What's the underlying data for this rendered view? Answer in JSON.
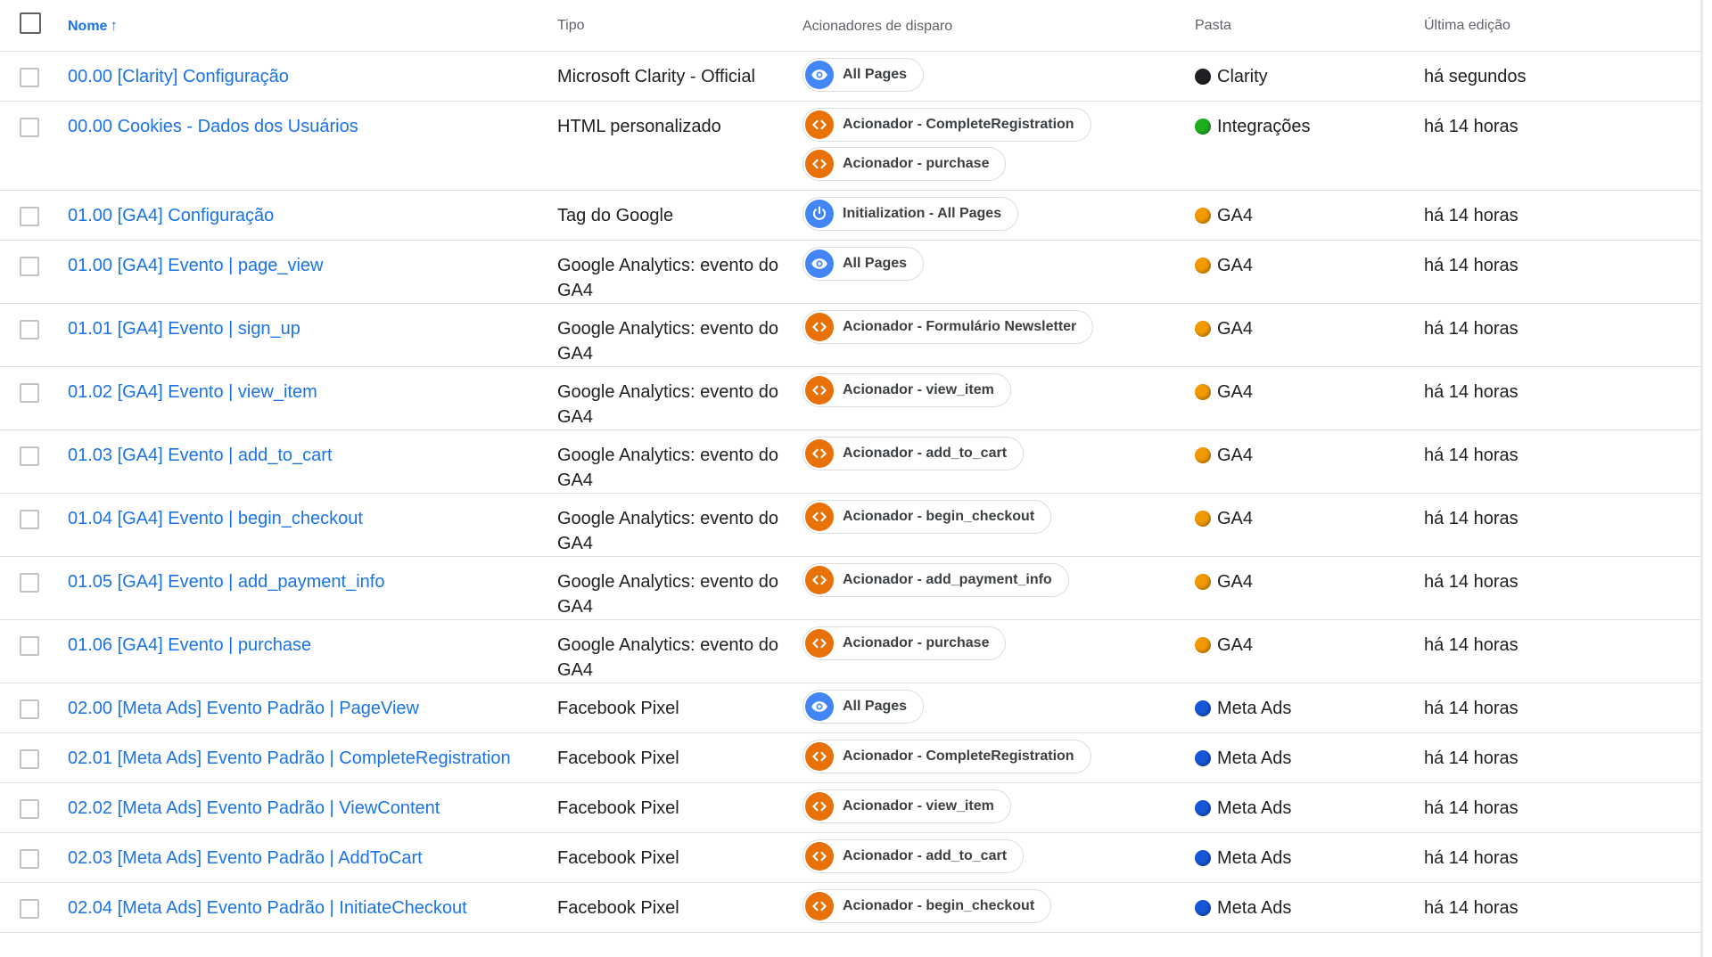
{
  "header": {
    "col_name": "Nome",
    "col_type": "Tipo",
    "col_triggers": "Acionadores de disparo",
    "col_folder": "Pasta",
    "col_edited": "Última edição"
  },
  "folder_colors": {
    "Clarity": "#202124",
    "Integrações": "#1db01d",
    "GA4": "#f29900",
    "Meta Ads": "#1558d6"
  },
  "trigger_colors": {
    "eye": "#4285f4",
    "power": "#4285f4",
    "code": "#e8710a"
  },
  "rows": [
    {
      "name": "00.00 [Clarity] Configuração",
      "type": "Microsoft Clarity - Official",
      "triggers": [
        {
          "label": "All Pages",
          "icon": "eye"
        }
      ],
      "folder": "Clarity",
      "edited": "há segundos"
    },
    {
      "name": "00.00 Cookies - Dados dos Usuários",
      "type": "HTML personalizado",
      "triggers": [
        {
          "label": "Acionador - CompleteRegistration",
          "icon": "code"
        },
        {
          "label": "Acionador - purchase",
          "icon": "code"
        }
      ],
      "folder": "Integrações",
      "edited": "há 14 horas"
    },
    {
      "name": "01.00 [GA4] Configuração",
      "type": "Tag do Google",
      "triggers": [
        {
          "label": "Initialization - All Pages",
          "icon": "power"
        }
      ],
      "folder": "GA4",
      "edited": "há 14 horas"
    },
    {
      "name": "01.00 [GA4] Evento | page_view",
      "type": "Google Analytics: evento do GA4",
      "triggers": [
        {
          "label": "All Pages",
          "icon": "eye"
        }
      ],
      "folder": "GA4",
      "edited": "há 14 horas"
    },
    {
      "name": "01.01 [GA4] Evento | sign_up",
      "type": "Google Analytics: evento do GA4",
      "triggers": [
        {
          "label": "Acionador - Formulário Newsletter",
          "icon": "code"
        }
      ],
      "folder": "GA4",
      "edited": "há 14 horas"
    },
    {
      "name": "01.02 [GA4] Evento | view_item",
      "type": "Google Analytics: evento do GA4",
      "triggers": [
        {
          "label": "Acionador - view_item",
          "icon": "code"
        }
      ],
      "folder": "GA4",
      "edited": "há 14 horas"
    },
    {
      "name": "01.03 [GA4] Evento | add_to_cart",
      "type": "Google Analytics: evento do GA4",
      "triggers": [
        {
          "label": "Acionador - add_to_cart",
          "icon": "code"
        }
      ],
      "folder": "GA4",
      "edited": "há 14 horas"
    },
    {
      "name": "01.04 [GA4] Evento | begin_checkout",
      "type": "Google Analytics: evento do GA4",
      "triggers": [
        {
          "label": "Acionador - begin_checkout",
          "icon": "code"
        }
      ],
      "folder": "GA4",
      "edited": "há 14 horas"
    },
    {
      "name": "01.05 [GA4] Evento | add_payment_info",
      "type": "Google Analytics: evento do GA4",
      "triggers": [
        {
          "label": "Acionador - add_payment_info",
          "icon": "code"
        }
      ],
      "folder": "GA4",
      "edited": "há 14 horas"
    },
    {
      "name": "01.06 [GA4] Evento | purchase",
      "type": "Google Analytics: evento do GA4",
      "triggers": [
        {
          "label": "Acionador - purchase",
          "icon": "code"
        }
      ],
      "folder": "GA4",
      "edited": "há 14 horas"
    },
    {
      "name": "02.00 [Meta Ads] Evento Padrão | PageView",
      "type": "Facebook Pixel",
      "triggers": [
        {
          "label": "All Pages",
          "icon": "eye"
        }
      ],
      "folder": "Meta Ads",
      "edited": "há 14 horas"
    },
    {
      "name": "02.01 [Meta Ads] Evento Padrão | CompleteRegistration",
      "type": "Facebook Pixel",
      "triggers": [
        {
          "label": "Acionador - CompleteRegistration",
          "icon": "code"
        }
      ],
      "folder": "Meta Ads",
      "edited": "há 14 horas"
    },
    {
      "name": "02.02 [Meta Ads] Evento Padrão | ViewContent",
      "type": "Facebook Pixel",
      "triggers": [
        {
          "label": "Acionador - view_item",
          "icon": "code"
        }
      ],
      "folder": "Meta Ads",
      "edited": "há 14 horas"
    },
    {
      "name": "02.03 [Meta Ads] Evento Padrão | AddToCart",
      "type": "Facebook Pixel",
      "triggers": [
        {
          "label": "Acionador - add_to_cart",
          "icon": "code"
        }
      ],
      "folder": "Meta Ads",
      "edited": "há 14 horas"
    },
    {
      "name": "02.04 [Meta Ads] Evento Padrão | InitiateCheckout",
      "type": "Facebook Pixel",
      "triggers": [
        {
          "label": "Acionador - begin_checkout",
          "icon": "code"
        }
      ],
      "folder": "Meta Ads",
      "edited": "há 14 horas"
    }
  ]
}
